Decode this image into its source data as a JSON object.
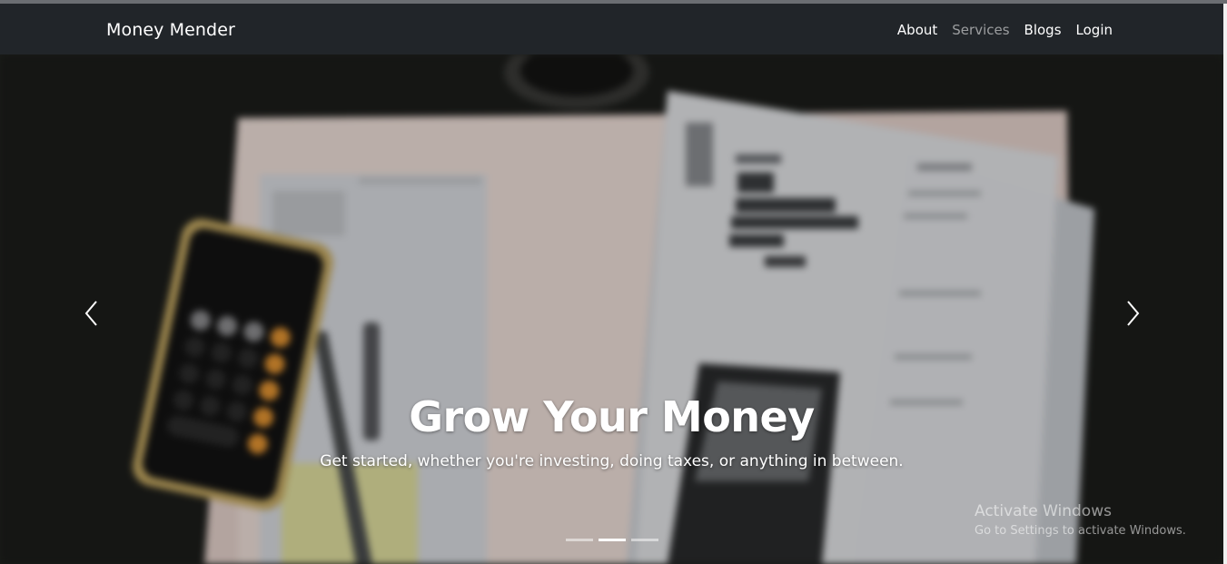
{
  "navbar": {
    "brand": "Money Mender",
    "links": [
      {
        "label": "About",
        "active": true
      },
      {
        "label": "Services",
        "active": false
      },
      {
        "label": "Blogs",
        "active": true
      },
      {
        "label": "Login",
        "active": true
      }
    ]
  },
  "carousel": {
    "title": "Grow Your Money",
    "subtitle": "Get started, whether you're investing, doing taxes, or anything in between.",
    "active_slide_index": 1,
    "slide_count": 3,
    "prev_icon": "chevron-left-icon",
    "next_icon": "chevron-right-icon"
  },
  "watermark": {
    "line1": "Activate Windows",
    "line2": "Go to Settings to activate Windows."
  },
  "colors": {
    "navbar_bg": "#212529",
    "link_active": "#ffffff",
    "link_muted": "rgba(255,255,255,0.55)"
  }
}
